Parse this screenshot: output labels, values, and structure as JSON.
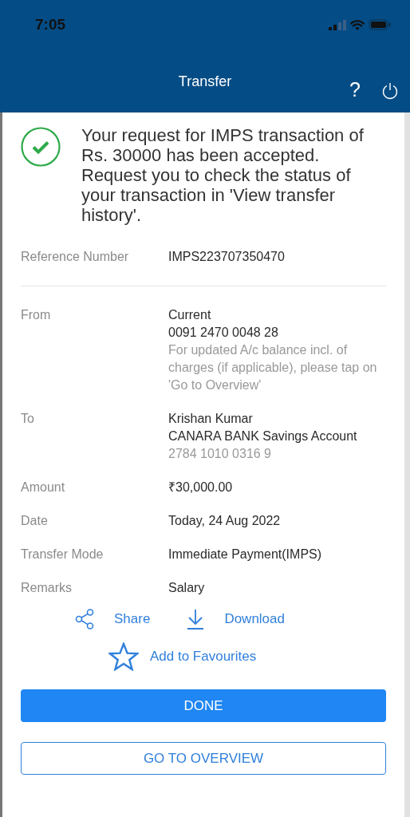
{
  "status_bar": {
    "time": "7:05"
  },
  "header": {
    "title": "Transfer",
    "help": "?"
  },
  "message": {
    "success": true,
    "text": "Your request for IMPS transaction of Rs. 30000 has been accepted. Request you to check the status of your transaction in 'View transfer history'."
  },
  "reference": {
    "label": "Reference Number",
    "value": "IMPS223707350470"
  },
  "details": [
    {
      "label": "From",
      "lines": [
        {
          "text": "Current",
          "muted": false
        },
        {
          "text": "0091 2470 0048 28",
          "muted": false
        },
        {
          "text": "For updated A/c balance incl. of charges (if applicable), please tap on 'Go to Overview'",
          "muted": true
        }
      ]
    },
    {
      "label": "To",
      "lines": [
        {
          "text": "Krishan Kumar",
          "muted": false
        },
        {
          "text": "CANARA BANK Savings Account",
          "muted": false
        },
        {
          "text": "2784 1010 0316 9",
          "muted": true
        }
      ]
    },
    {
      "label": "Amount",
      "lines": [
        {
          "text": "₹30,000.00",
          "muted": false
        }
      ]
    },
    {
      "label": "Date",
      "lines": [
        {
          "text": "Today, 24 Aug 2022",
          "muted": false
        }
      ]
    },
    {
      "label": "Transfer Mode",
      "lines": [
        {
          "text": "Immediate Payment(IMPS)",
          "muted": false
        }
      ]
    },
    {
      "label": "Remarks",
      "lines": [
        {
          "text": "Salary",
          "muted": false
        }
      ]
    }
  ],
  "actions": [
    {
      "kind": "share",
      "label": "Share"
    },
    {
      "kind": "download",
      "label": "Download"
    }
  ],
  "favourite": {
    "label": "Add to Favourites"
  },
  "buttons": [
    {
      "kind": "primary",
      "label": "DONE"
    },
    {
      "kind": "outline",
      "label": "GO TO OVERVIEW"
    }
  ]
}
